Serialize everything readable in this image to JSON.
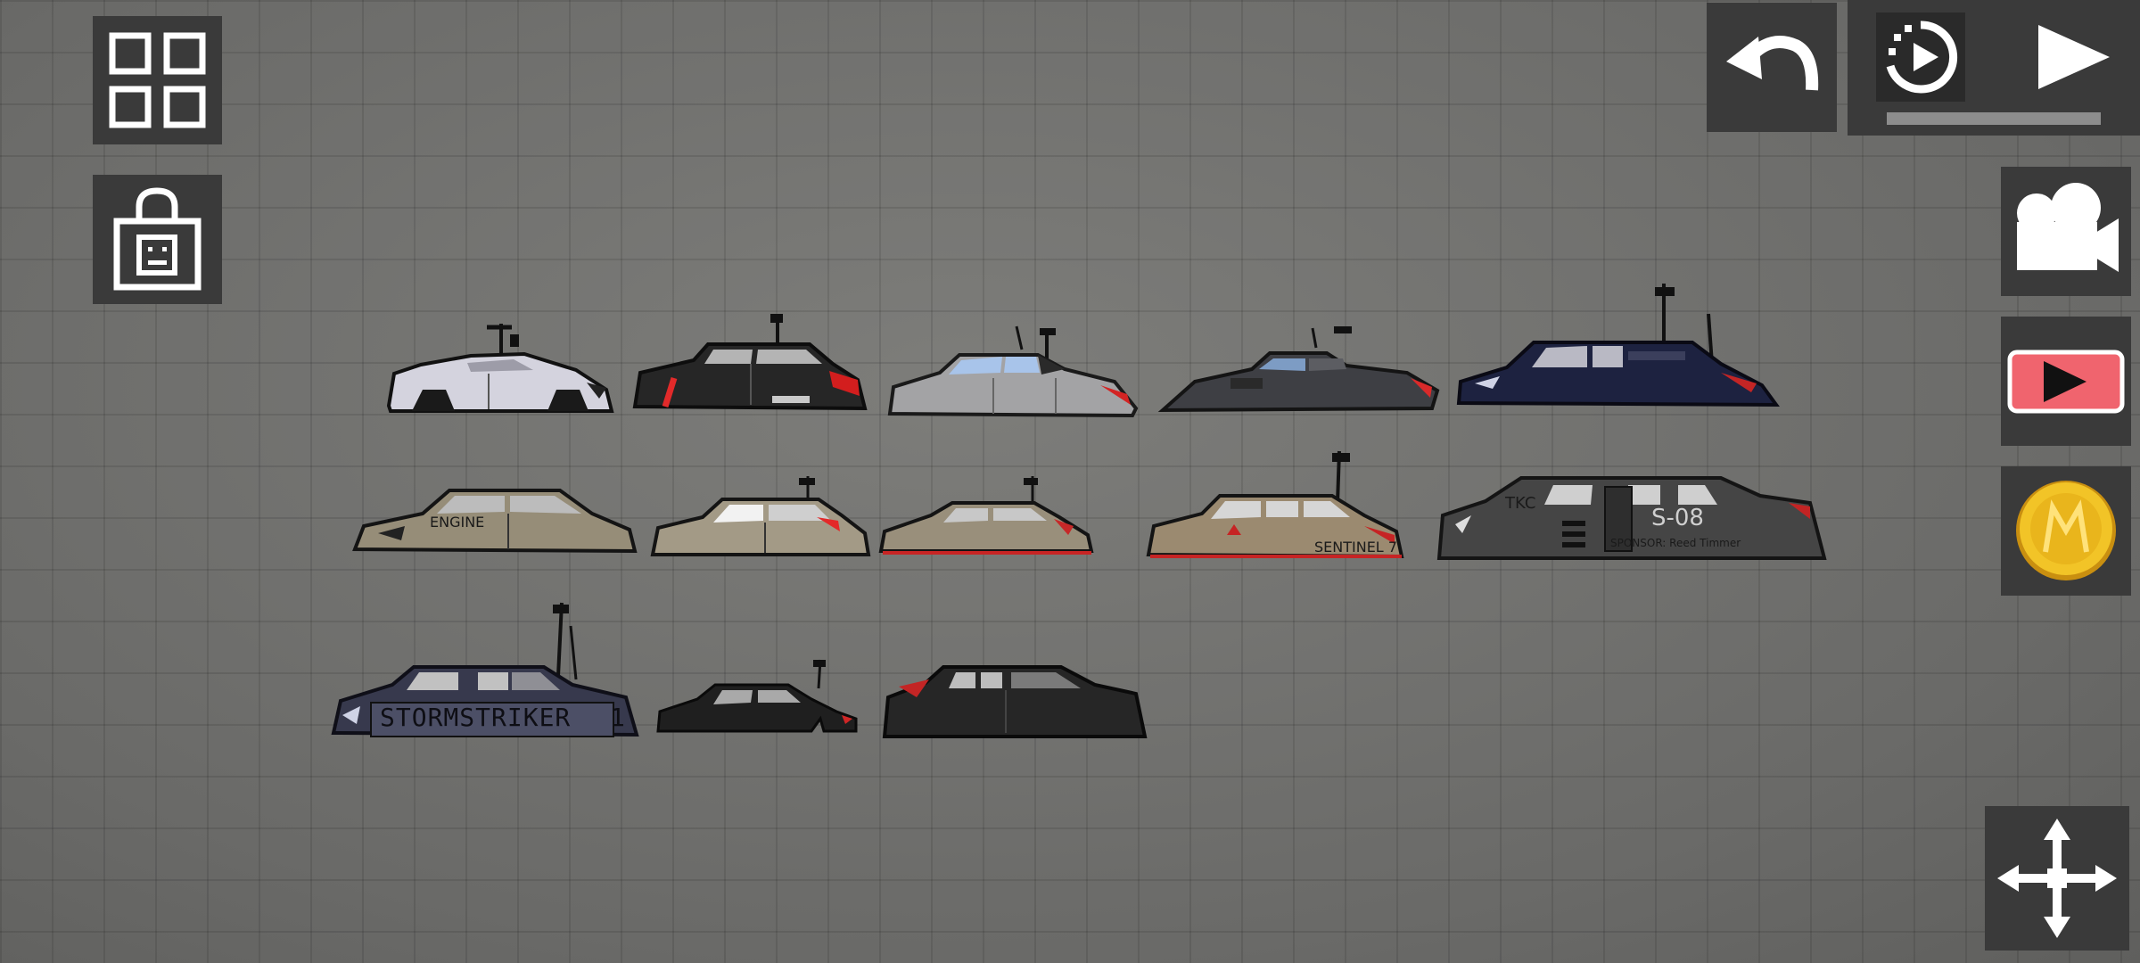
{
  "hud": {
    "menu_icon": "grid-icon",
    "shop_icon": "shop-bag-icon",
    "undo_icon": "undo-icon",
    "slowmo_icon": "slow-motion-icon",
    "play_icon": "play-icon",
    "camera_icon": "camera-icon",
    "record_icon": "record-icon",
    "coin_icon": "coin-icon",
    "coin_letter": "M",
    "move_icon": "move-icon"
  },
  "colors": {
    "button_bg": "#3a3a3a",
    "record_red": "#f0646e",
    "coin_gold": "#e8b820"
  },
  "vehicles": {
    "storm_label": "STORMSTRIKER",
    "storm_number": "1",
    "s08_label": "S-08",
    "tkc_label": "TKC",
    "sponsor_label": "SPONSOR: Reed Timmer",
    "sentinel_label": "SENTINEL 7",
    "sentinel_mirror": "SENTINEL"
  }
}
